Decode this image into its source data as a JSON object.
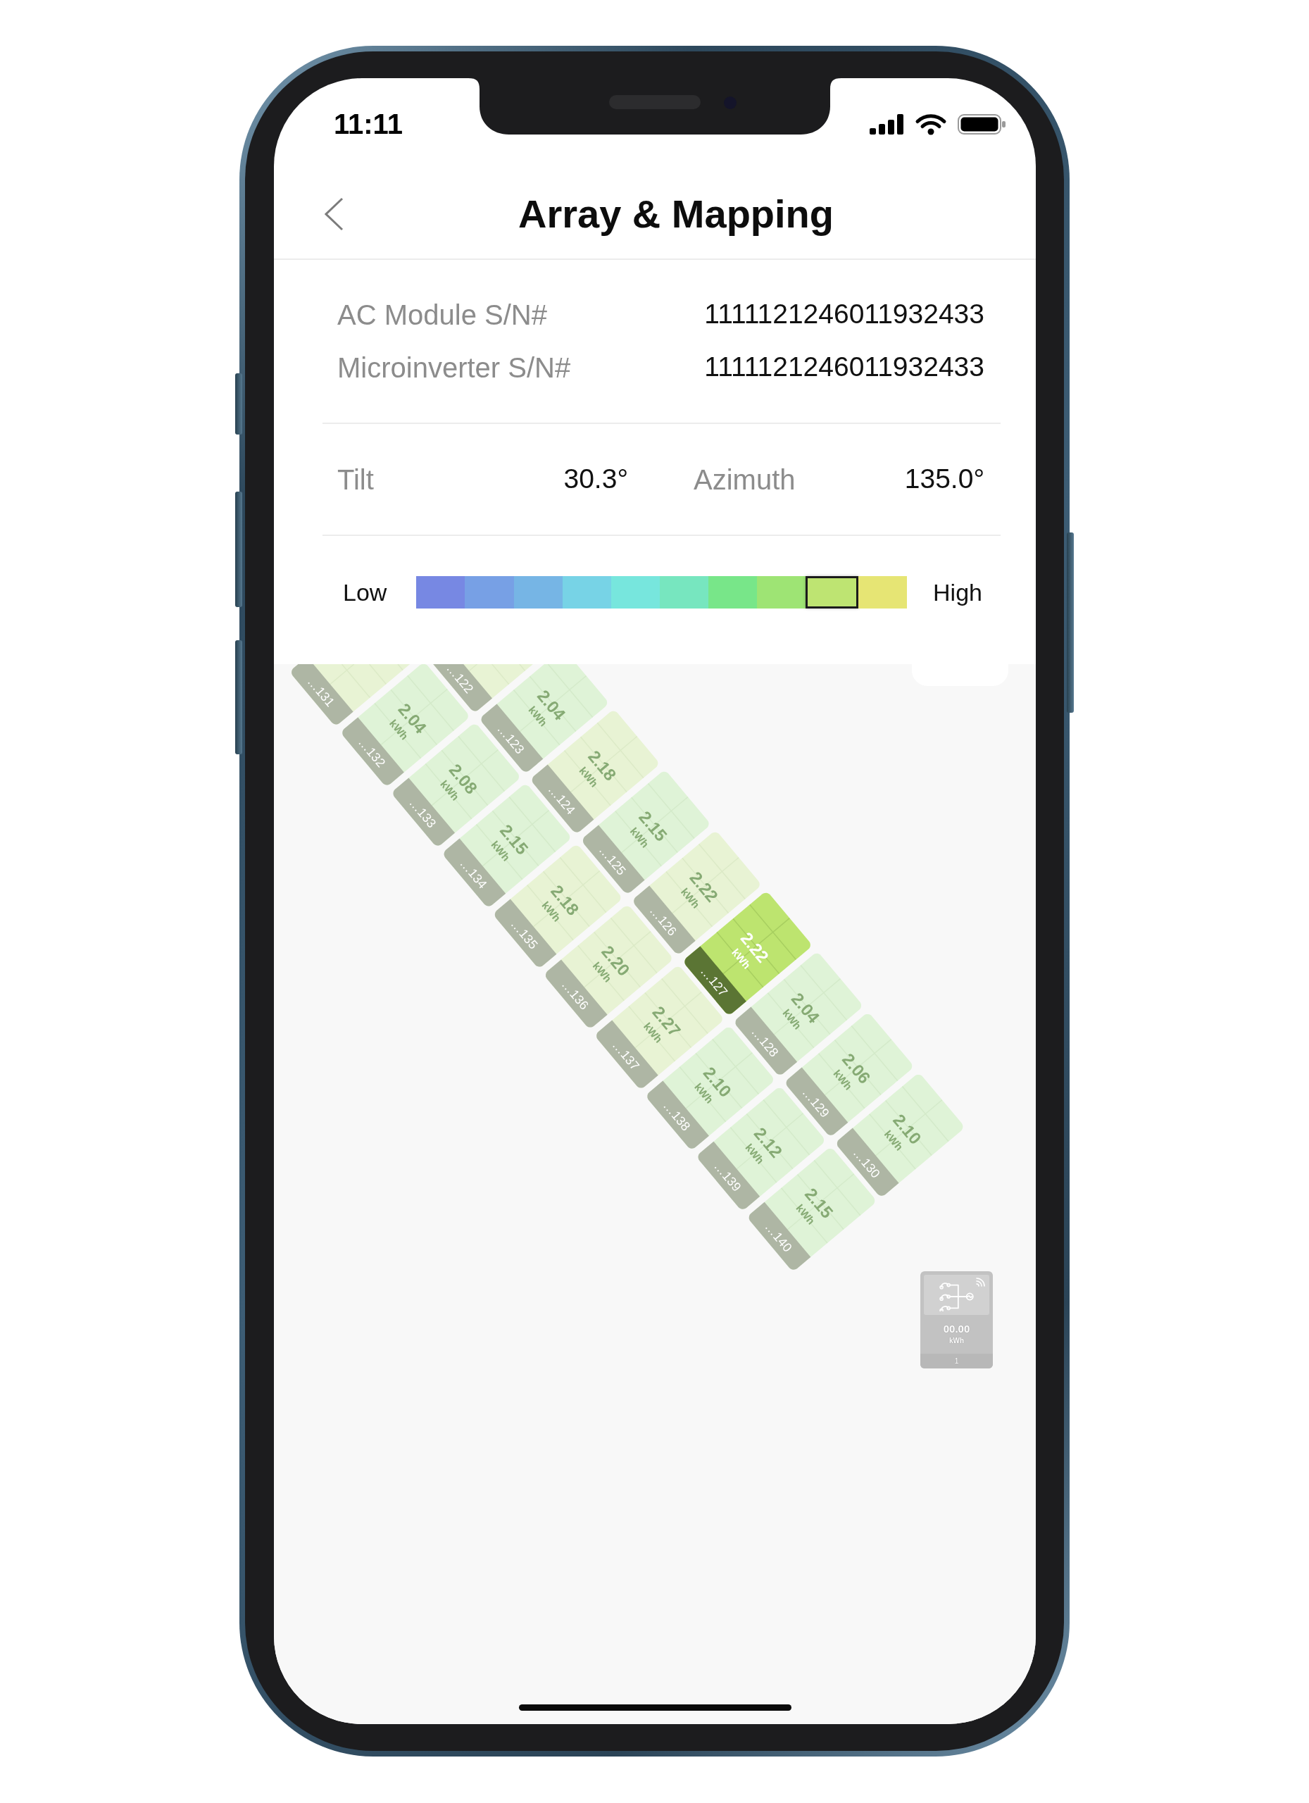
{
  "status_bar": {
    "time": "11:11"
  },
  "header": {
    "title": "Array & Mapping"
  },
  "serials": [
    {
      "label": "AC Module S/N#",
      "value": "1111121246011932433"
    },
    {
      "label": "Microinverter S/N#",
      "value": "1111121246011932433"
    }
  ],
  "orientation": [
    {
      "label": "Tilt",
      "value": "30.3°"
    },
    {
      "label": "Azimuth",
      "value": "135.0°"
    }
  ],
  "legend": {
    "low_label": "Low",
    "high_label": "High",
    "segments": [
      {
        "color": "#7788e3",
        "selected": false
      },
      {
        "color": "#77a0e5",
        "selected": false
      },
      {
        "color": "#76b5e5",
        "selected": false
      },
      {
        "color": "#77d3e6",
        "selected": false
      },
      {
        "color": "#77e6dd",
        "selected": false
      },
      {
        "color": "#77e6bf",
        "selected": false
      },
      {
        "color": "#78e689",
        "selected": false
      },
      {
        "color": "#9ee474",
        "selected": false
      },
      {
        "color": "#bee472",
        "selected": true
      },
      {
        "color": "#e6e574",
        "selected": false
      }
    ]
  },
  "array_map": {
    "rows": [
      {
        "panels": [
          {
            "id_label": "…122",
            "color": "#e8f3d4",
            "selected": false
          },
          {
            "id_label": "…123",
            "value": "2.04",
            "unit": "kWh",
            "color": "#dff3d7",
            "selected": false
          },
          {
            "id_label": "…124",
            "value": "2.18",
            "unit": "kWh",
            "color": "#e8f3d4",
            "selected": false
          },
          {
            "id_label": "…125",
            "value": "2.15",
            "unit": "kWh",
            "color": "#dff3d7",
            "selected": false
          },
          {
            "id_label": "…126",
            "value": "2.22",
            "unit": "kWh",
            "color": "#e8f3d4",
            "selected": false
          },
          {
            "id_label": "…127",
            "value": "2.22",
            "unit": "kWh",
            "color": "#bde46f",
            "selected": true
          },
          {
            "id_label": "…128",
            "value": "2.04",
            "unit": "kWh",
            "color": "#dff3d7",
            "selected": false
          },
          {
            "id_label": "…129",
            "value": "2.06",
            "unit": "kWh",
            "color": "#dff3d7",
            "selected": false
          },
          {
            "id_label": "…130",
            "value": "2.10",
            "unit": "kWh",
            "color": "#dff3d7",
            "selected": false
          }
        ]
      },
      {
        "panels": [
          {
            "id_label": "…131",
            "color": "#e8f3d4",
            "selected": false
          },
          {
            "id_label": "…132",
            "value": "2.04",
            "unit": "kWh",
            "color": "#dff3d7",
            "selected": false
          },
          {
            "id_label": "…133",
            "value": "2.08",
            "unit": "kWh",
            "color": "#dff3d7",
            "selected": false
          },
          {
            "id_label": "…134",
            "value": "2.15",
            "unit": "kWh",
            "color": "#dff3d7",
            "selected": false
          },
          {
            "id_label": "…135",
            "value": "2.18",
            "unit": "kWh",
            "color": "#e8f3d4",
            "selected": false
          },
          {
            "id_label": "…136",
            "value": "2.20",
            "unit": "kWh",
            "color": "#e8f3d4",
            "selected": false
          },
          {
            "id_label": "…137",
            "value": "2.27",
            "unit": "kWh",
            "color": "#e8f3d4",
            "selected": false
          },
          {
            "id_label": "…138",
            "value": "2.10",
            "unit": "kWh",
            "color": "#dff3d7",
            "selected": false
          },
          {
            "id_label": "…139",
            "value": "2.12",
            "unit": "kWh",
            "color": "#dff3d7",
            "selected": false
          },
          {
            "id_label": "…140",
            "value": "2.15",
            "unit": "kWh",
            "color": "#dff3d7",
            "selected": false
          }
        ]
      }
    ],
    "gateway": {
      "value": "00.00",
      "unit": "kWh",
      "count": "1"
    }
  }
}
